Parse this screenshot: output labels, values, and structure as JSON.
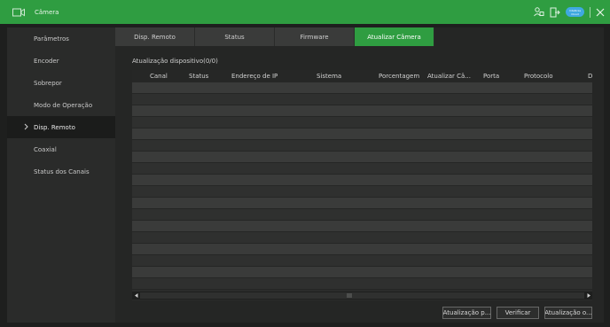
{
  "window": {
    "title": "Câmera",
    "accent": "#2f9d41",
    "smart_badge": "Intelbras Cloud"
  },
  "sidebar": {
    "items": [
      {
        "label": "Parâmetros",
        "active": false
      },
      {
        "label": "Encoder",
        "active": false
      },
      {
        "label": "Sobrepor",
        "active": false
      },
      {
        "label": "Modo de Operação",
        "active": false
      },
      {
        "label": "Disp. Remoto",
        "active": true
      },
      {
        "label": "Coaxial",
        "active": false
      },
      {
        "label": "Status dos Canais",
        "active": false
      }
    ]
  },
  "tabs": [
    {
      "label": "Disp. Remoto",
      "active": false
    },
    {
      "label": "Status",
      "active": false
    },
    {
      "label": "Firmware",
      "active": false
    },
    {
      "label": "Atualizar Câmera",
      "active": true
    }
  ],
  "section": {
    "title": "Atualização dispositivo(0/0)"
  },
  "table": {
    "headers": [
      "Canal",
      "Status",
      "Endereço de IP",
      "Sistema",
      "Porcentagem",
      "Atualizar Câ...",
      "Porta",
      "Protocolo",
      "D"
    ],
    "rows": []
  },
  "buttons": {
    "update_partial": "Atualização p...",
    "verify": "Verificar",
    "update_online": "Atualização o..."
  }
}
